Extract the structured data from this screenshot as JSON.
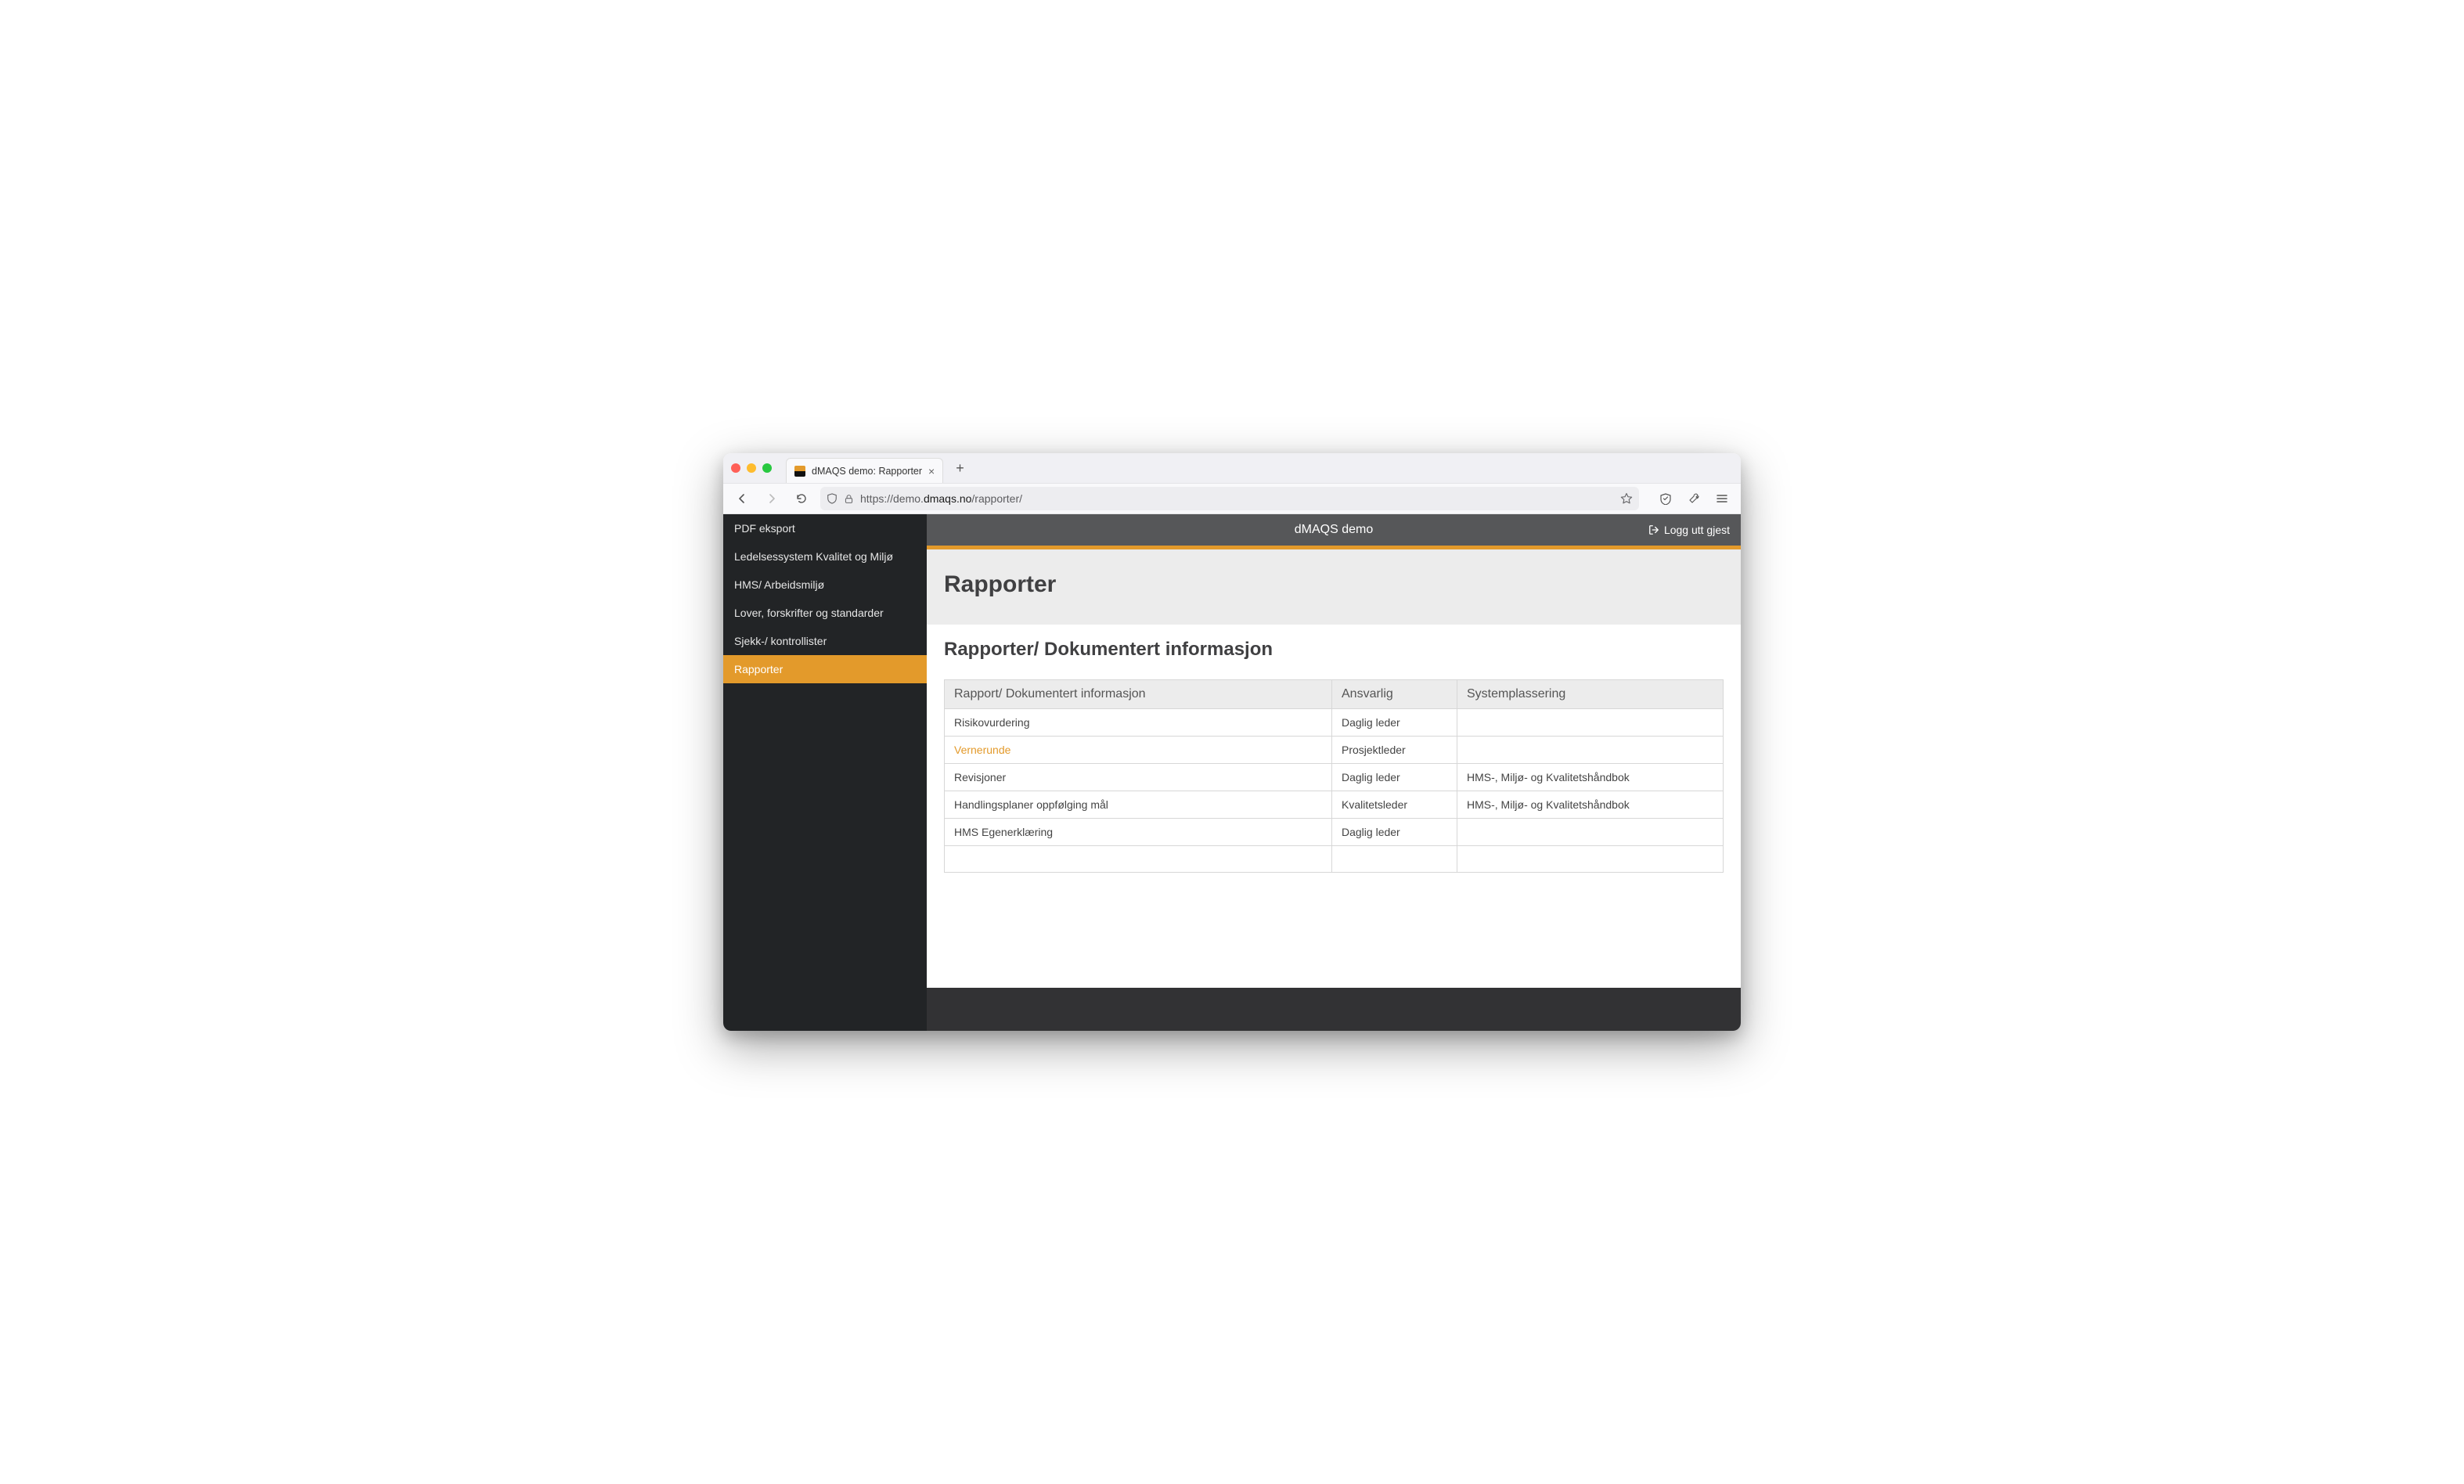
{
  "browser": {
    "tab_title": "dMAQS demo: Rapporter",
    "url_prefix": "https://demo.",
    "url_domain": "dmaqs.no",
    "url_path": "/rapporter/"
  },
  "sidebar": {
    "items": [
      {
        "label": "PDF eksport",
        "active": false
      },
      {
        "label": "Ledelsessystem Kvalitet og Miljø",
        "active": false
      },
      {
        "label": "HMS/ Arbeidsmiljø",
        "active": false
      },
      {
        "label": "Lover, forskrifter og standarder",
        "active": false
      },
      {
        "label": "Sjekk-/ kontrollister",
        "active": false
      },
      {
        "label": "Rapporter",
        "active": true
      }
    ]
  },
  "header": {
    "app_title": "dMAQS demo",
    "logout_label": "Logg utt gjest"
  },
  "page": {
    "title": "Rapporter",
    "subtitle": "Rapporter/ Dokumentert informasjon"
  },
  "table": {
    "columns": [
      "Rapport/ Dokumentert informasjon",
      "Ansvarlig",
      "Systemplassering"
    ],
    "rows": [
      {
        "name": "Risikovurdering",
        "link": false,
        "ansvarlig": "Daglig leder",
        "plassering": ""
      },
      {
        "name": "Vernerunde",
        "link": true,
        "ansvarlig": "Prosjektleder",
        "plassering": ""
      },
      {
        "name": "Revisjoner",
        "link": false,
        "ansvarlig": "Daglig leder",
        "plassering": "HMS-, Miljø- og Kvalitetshåndbok"
      },
      {
        "name": "Handlingsplaner oppfølging mål",
        "link": false,
        "ansvarlig": "Kvalitetsleder",
        "plassering": "HMS-, Miljø- og Kvalitetshåndbok"
      },
      {
        "name": "HMS Egenerklæring",
        "link": false,
        "ansvarlig": "Daglig leder",
        "plassering": ""
      }
    ]
  }
}
